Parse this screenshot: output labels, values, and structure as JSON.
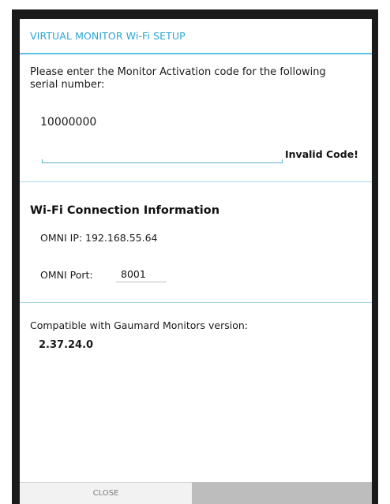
{
  "dialog": {
    "title": "VIRTUAL MONITOR Wi-Fi SETUP",
    "prompt": "Please enter the Monitor Activation code for the following serial number:",
    "serial_number": "10000000",
    "activation_code": {
      "value": "",
      "placeholder": ""
    },
    "error_message": "Invalid Code!"
  },
  "wifi": {
    "heading": "Wi-Fi Connection Information",
    "ip_label": "OMNI IP: 192.168.55.64",
    "port_label": "OMNI Port:",
    "port_value": "8001"
  },
  "compat": {
    "label": "Compatible with Gaumard Monitors version:",
    "version": "2.37.24.0"
  },
  "buttons": {
    "close_label": "CLOSE"
  },
  "colors": {
    "accent": "#2aa5d6",
    "divider": "#a9d8ea",
    "frame": "#1b1b1b"
  }
}
